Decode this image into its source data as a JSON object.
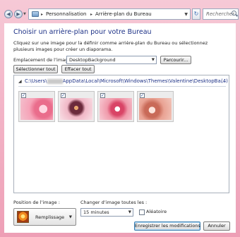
{
  "address_bar": {
    "crumbs": [
      "Personnalisation",
      "Arrière-plan du Bureau"
    ],
    "separator": "▸",
    "search_placeholder": "Rechercher"
  },
  "page": {
    "title": "Choisir un arrière-plan pour votre Bureau",
    "description": "Cliquez sur une image pour la définir comme arrière-plan du Bureau ou sélectionnez plusieurs images pour créer un diaporama."
  },
  "location": {
    "label": "Emplacement de l’image :",
    "value": "DesktopBackground",
    "browse_label": "Parcourir..."
  },
  "selection": {
    "select_all_label": "Sélectionner tout",
    "clear_all_label": "Effacer tout"
  },
  "gallery": {
    "group_path_prefix": "C:\\Users\\",
    "group_path_suffix": "AppData\\Local\\Microsoft\\Windows\\Themes\\Valentine\\DesktopBa...",
    "group_count": "(4)",
    "checkmark": "✓",
    "images": [
      {
        "name": "wallpaper-1",
        "checked": true
      },
      {
        "name": "wallpaper-2",
        "checked": true
      },
      {
        "name": "wallpaper-3",
        "checked": true
      },
      {
        "name": "wallpaper-4",
        "checked": true
      }
    ]
  },
  "position": {
    "label": "Position de l’image :",
    "value": "Remplissage"
  },
  "interval": {
    "label": "Changer d’image toutes les :",
    "value": "15 minutes"
  },
  "shuffle": {
    "label": "Aléatoire",
    "checked": false
  },
  "footer": {
    "save_label": "Enregistrer les modifications",
    "cancel_label": "Annuler"
  },
  "icons": {
    "back": "◀",
    "forward": "▶",
    "dropdown": "▼",
    "refresh": "↻",
    "group_collapse": "◢"
  }
}
